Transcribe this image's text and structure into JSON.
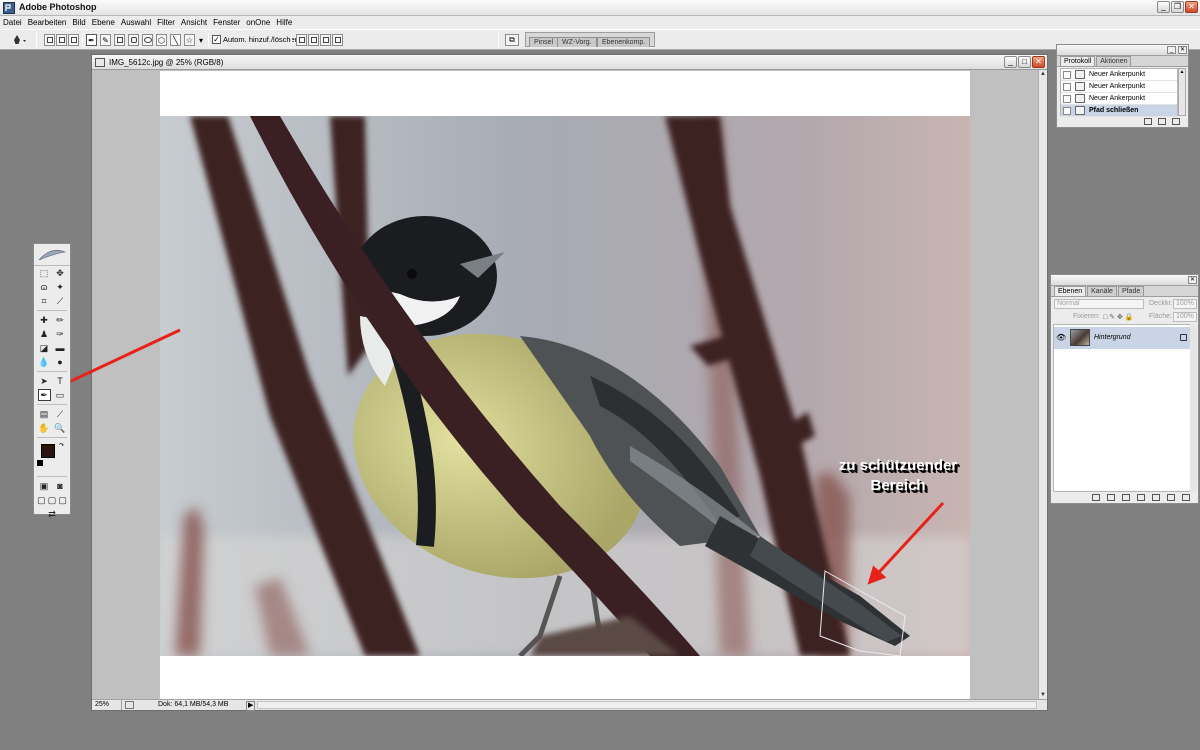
{
  "app": {
    "title": "Adobe Photoshop",
    "minimize": "_",
    "maximize": "❐",
    "close": "✕"
  },
  "menu": [
    "Datei",
    "Bearbeiten",
    "Bild",
    "Ebene",
    "Auswahl",
    "Filter",
    "Ansicht",
    "Fenster",
    "onOne",
    "Hilfe"
  ],
  "options_bar": {
    "auto_add_delete_label": "Autom. hinzuf./löschen",
    "auto_add_delete_checked": true,
    "palette_well_tabs": [
      "Pinsel",
      "WZ-Vorg.",
      "Ebenenkomp."
    ]
  },
  "document": {
    "title": "IMG_5612c.jpg @ 25% (RGB/8)",
    "zoom": "25%",
    "doc_info": "Dok: 64,1 MB/54,3 MB"
  },
  "annotation": {
    "line1": "zu schützuender",
    "line2": "Bereich"
  },
  "history": {
    "tabs": [
      "Protokoll",
      "Aktionen"
    ],
    "items": [
      "Neuer Ankerpunkt",
      "Neuer Ankerpunkt",
      "Neuer Ankerpunkt",
      "Pfad schließen"
    ]
  },
  "layers": {
    "tabs": [
      "Ebenen",
      "Kanäle",
      "Pfade"
    ],
    "blend_mode": "Normal",
    "opacity_label": "Deckkr.:",
    "opacity_value": "100%",
    "lock_label": "Fixieren:",
    "fill_label": "Fläche:",
    "fill_value": "100%",
    "layer_name": "Hintergrund"
  },
  "colors": {
    "foreground": "#2a1410",
    "background": "#ffffff",
    "annotation_arrow": "#e8221b"
  }
}
